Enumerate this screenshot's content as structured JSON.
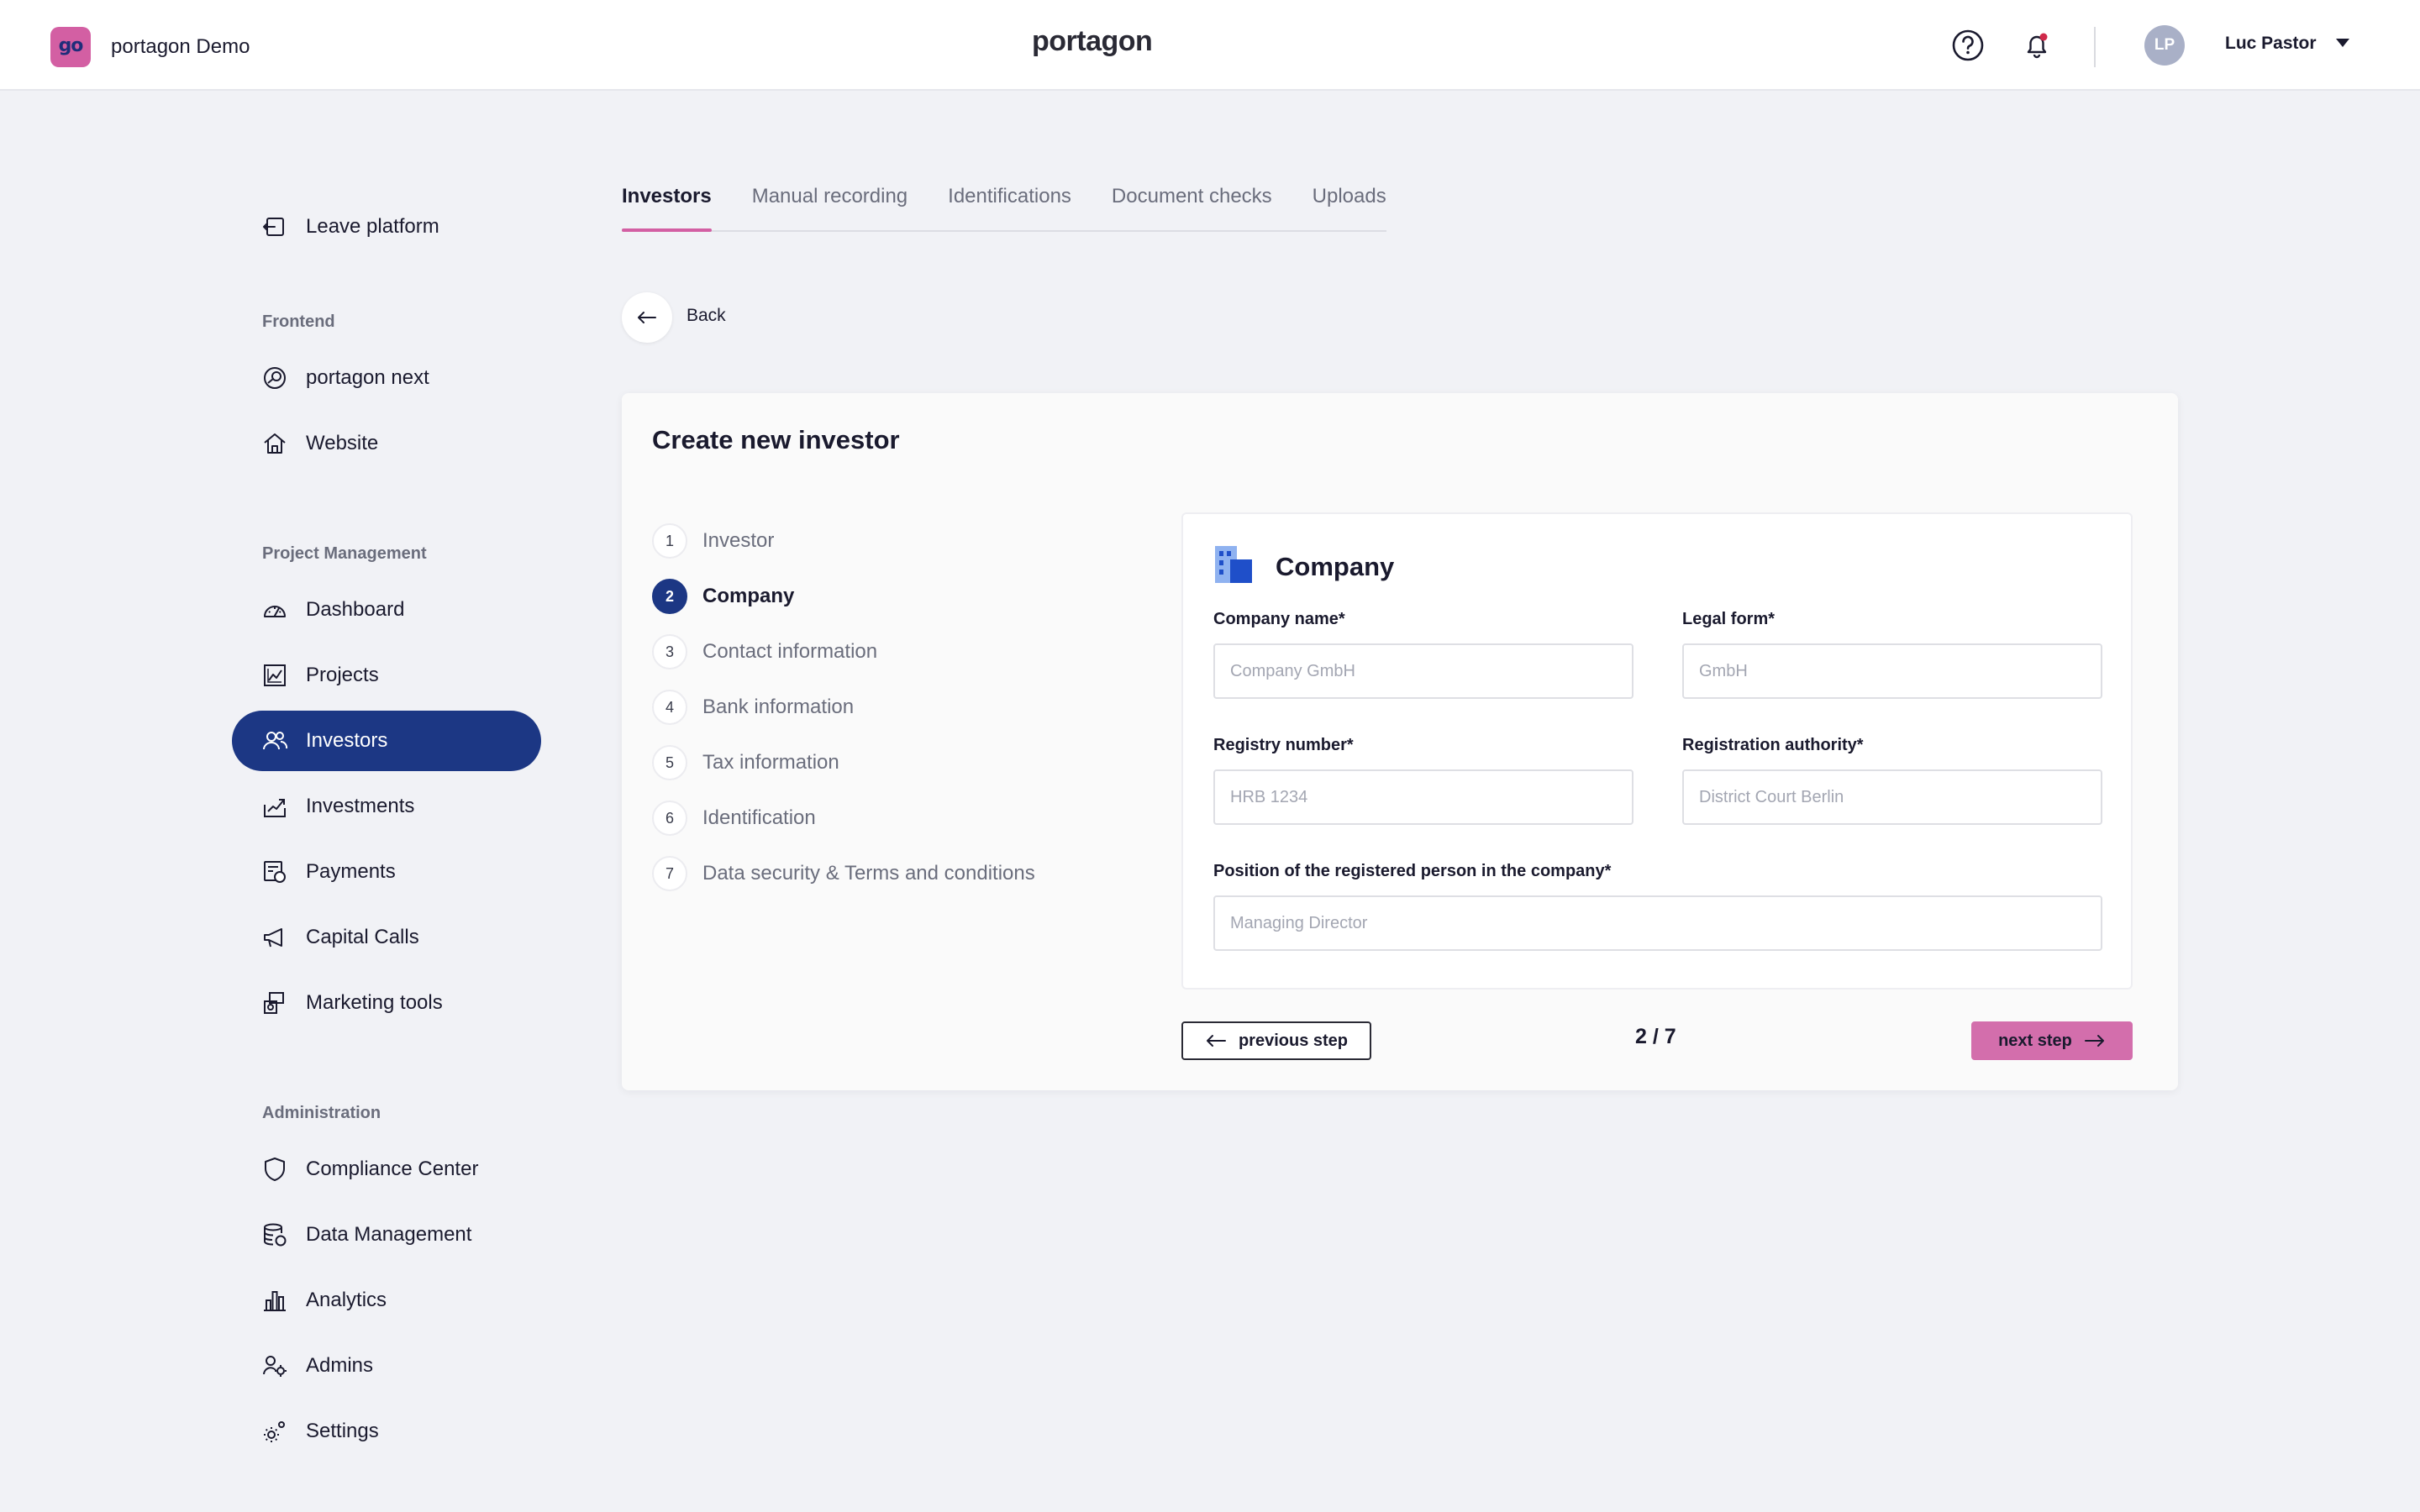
{
  "header": {
    "app_logo_text": "go",
    "app_name": "portagon Demo",
    "brand": "portagon",
    "user": {
      "initials": "LP",
      "name": "Luc Pastor"
    },
    "icons": [
      "help-icon",
      "bell-icon",
      "chevron-down-icon"
    ]
  },
  "sidebar": {
    "leave": {
      "label": "Leave platform",
      "icon": "leave-icon"
    },
    "frontend_title": "Frontend",
    "frontend_items": [
      {
        "label": "portagon next",
        "icon": "portagon-next-icon"
      },
      {
        "label": "Website",
        "icon": "home-icon"
      }
    ],
    "pm_title": "Project Management",
    "pm_items": [
      {
        "label": "Dashboard",
        "icon": "gauge-icon"
      },
      {
        "label": "Projects",
        "icon": "chart-icon"
      },
      {
        "label": "Investors",
        "icon": "users-icon",
        "active": true
      },
      {
        "label": "Investments",
        "icon": "investment-icon"
      },
      {
        "label": "Payments",
        "icon": "payments-icon"
      },
      {
        "label": "Capital Calls",
        "icon": "megaphone-icon"
      },
      {
        "label": "Marketing tools",
        "icon": "marketing-icon"
      }
    ],
    "admin_title": "Administration",
    "admin_items": [
      {
        "label": "Compliance Center",
        "icon": "shield-icon"
      },
      {
        "label": "Data Management",
        "icon": "database-icon"
      },
      {
        "label": "Analytics",
        "icon": "bar-chart-icon"
      },
      {
        "label": "Admins",
        "icon": "admin-icon"
      },
      {
        "label": "Settings",
        "icon": "gear-icon"
      }
    ]
  },
  "tabs": [
    "Investors",
    "Manual recording",
    "Identifications",
    "Document checks",
    "Uploads"
  ],
  "active_tab": "Investors",
  "back_label": "Back",
  "card": {
    "title": "Create new investor",
    "steps": [
      {
        "num": "1",
        "label": "Investor"
      },
      {
        "num": "2",
        "label": "Company",
        "current": true
      },
      {
        "num": "3",
        "label": "Contact information"
      },
      {
        "num": "4",
        "label": "Bank information"
      },
      {
        "num": "5",
        "label": "Tax information"
      },
      {
        "num": "6",
        "label": "Identification"
      },
      {
        "num": "7",
        "label": "Data security & Terms and conditions"
      }
    ],
    "form": {
      "title": "Company",
      "icon": "building-icon",
      "company_name": {
        "label": "Company name*",
        "value": "",
        "placeholder": "Company GmbH"
      },
      "legal_form": {
        "label": "Legal form*",
        "value": "",
        "placeholder": "GmbH"
      },
      "registry_number": {
        "label": "Registry number*",
        "value": "",
        "placeholder": "HRB 1234"
      },
      "registration_authority": {
        "label": "Registration authority*",
        "value": "",
        "placeholder": "District Court Berlin"
      },
      "position": {
        "label": "Position of the registered person in the company*",
        "value": "",
        "placeholder": "Managing Director"
      }
    },
    "prev_label": "previous step",
    "pager": "2 / 7",
    "next_label": "next step"
  },
  "colors": {
    "primary_navy": "#1c3784",
    "accent_pink": "#d35fa3",
    "next_button": "#d36eac",
    "background": "#f1f2f6"
  }
}
